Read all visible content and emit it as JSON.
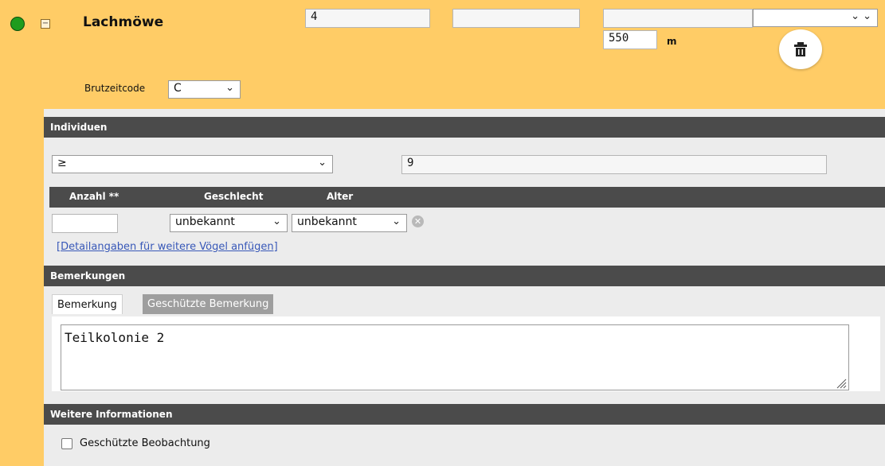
{
  "header": {
    "species": "Lachmöwe",
    "count_value": "4",
    "field2_value": "",
    "field3_value": "",
    "field4_value": "",
    "distance_value": "550",
    "distance_unit": "m",
    "status_color": "#1e9c1e"
  },
  "breeding": {
    "label": "Brutzeitcode",
    "value": "C"
  },
  "individuals": {
    "title": "Individuen",
    "operator": "≥",
    "count": "9",
    "columns": [
      "Anzahl **",
      "Geschlecht",
      "Alter"
    ],
    "row": {
      "anzahl": "",
      "geschlecht": "unbekannt",
      "alter": "unbekannt"
    },
    "add_link": "[Detailangaben für weitere Vögel anfügen]"
  },
  "remarks": {
    "title": "Bemerkungen",
    "tabs": [
      "Bemerkung",
      "Geschützte Bemerkung"
    ],
    "text": "Teilkolonie 2"
  },
  "more_info": {
    "title": "Weitere Informationen",
    "protected_label": "Geschützte Beobachtung",
    "protected_checked": false
  }
}
